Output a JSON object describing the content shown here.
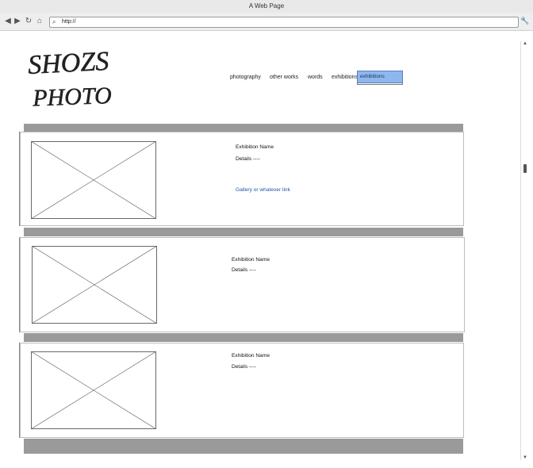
{
  "window": {
    "title": "A Web Page"
  },
  "toolbar": {
    "url": "http://"
  },
  "logo": {
    "line1": "SHOZS",
    "line2": "PHOTO"
  },
  "nav": {
    "items": [
      "photography",
      "other works",
      "words",
      "exhibitions"
    ],
    "dropdown_selected": "exhibitions"
  },
  "exhibitions": [
    {
      "name": "Exhibition Name",
      "details": "Details ----",
      "link": "Gallery or whatever link"
    },
    {
      "name": "Exhibition Name",
      "details": "Details ----"
    },
    {
      "name": "Exhibition Name",
      "details": "Details ----"
    }
  ],
  "colors": {
    "band": "#9a9a9a",
    "dropdown_bg": "#8fb7ef",
    "link": "#1d57a6"
  }
}
